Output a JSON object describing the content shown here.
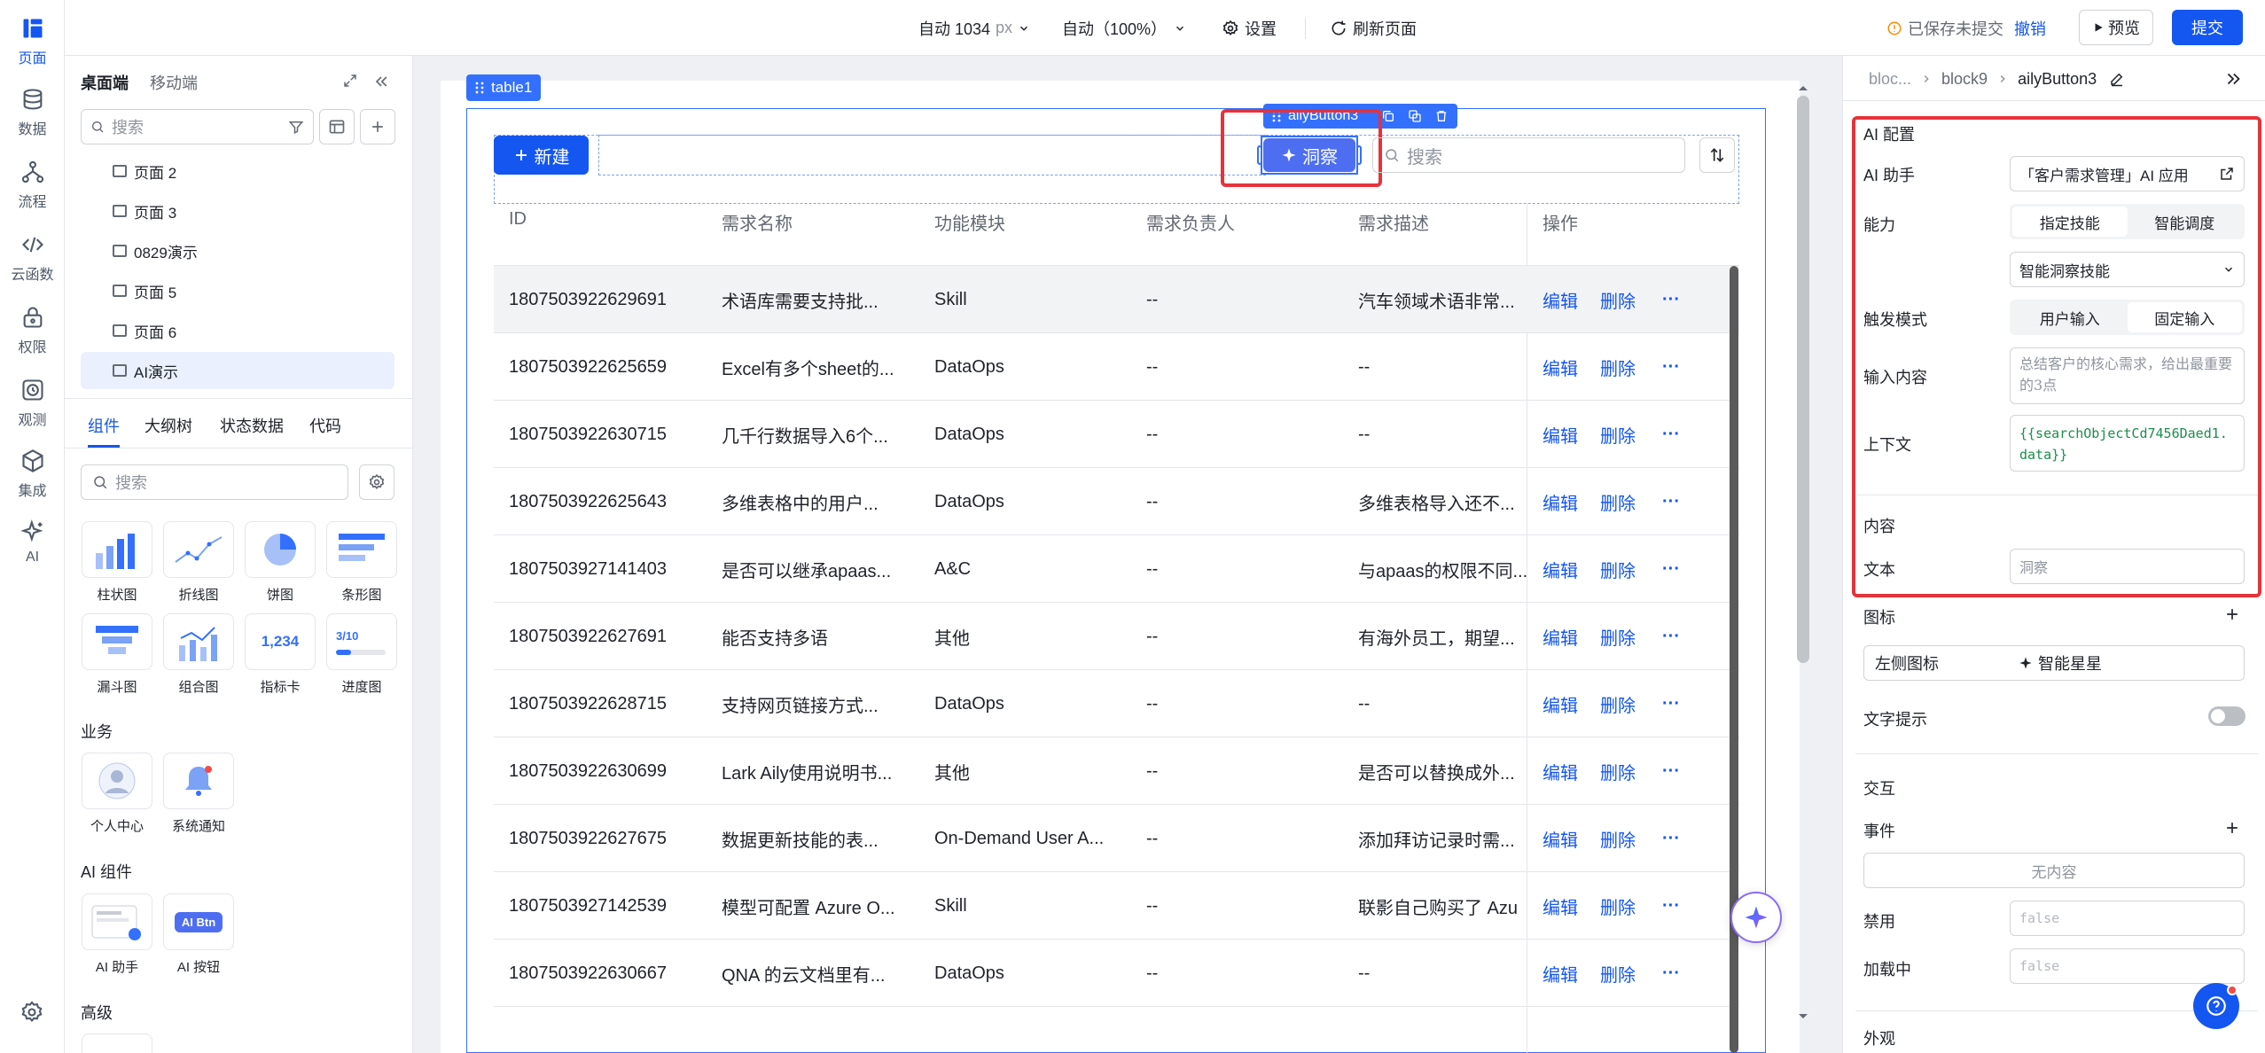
{
  "rail": {
    "items": [
      {
        "label": "页面",
        "icon": "page-icon",
        "active": true
      },
      {
        "label": "数据",
        "icon": "database-icon"
      },
      {
        "label": "流程",
        "icon": "flow-icon"
      },
      {
        "label": "云函数",
        "icon": "code-icon"
      },
      {
        "label": "权限",
        "icon": "lock-icon"
      },
      {
        "label": "观测",
        "icon": "monitor-icon"
      },
      {
        "label": "集成",
        "icon": "cube-icon"
      },
      {
        "label": "AI",
        "icon": "sparkle-icon"
      }
    ]
  },
  "topbar": {
    "width_label": "自动 1034",
    "width_unit": "px",
    "zoom_label": "自动（100%）",
    "settings_label": "设置",
    "refresh_label": "刷新页面",
    "save_status": "已保存未提交",
    "revoke_label": "撤销",
    "preview_label": "预览",
    "submit_label": "提交"
  },
  "left": {
    "device_tabs": [
      "桌面端",
      "移动端"
    ],
    "search_placeholder": "搜索",
    "pages": [
      "页面 2",
      "页面 3",
      "0829演示",
      "页面 5",
      "页面 6",
      "AI演示"
    ],
    "panel_tabs": [
      "组件",
      "大纲树",
      "状态数据",
      "代码"
    ],
    "component_search_placeholder": "搜索",
    "charts": [
      "柱状图",
      "折线图",
      "饼图",
      "条形图",
      "漏斗图",
      "组合图",
      "指标卡",
      "进度图"
    ],
    "metric_card_text": "1,234",
    "progress_text": "3/10",
    "business_title": "业务",
    "business": [
      "个人中心",
      "系统通知"
    ],
    "ai_title": "AI 组件",
    "ai_components": [
      "AI 助手",
      "AI 按钮"
    ],
    "ai_btn_thumb": "AI Btn",
    "advanced_title": "高级"
  },
  "canvas": {
    "table_tag": "table1",
    "button_tag": "ailyButton3",
    "new_button": "新建",
    "insight_button": "洞察",
    "search_placeholder": "搜索",
    "columns": [
      "ID",
      "需求名称",
      "功能模块",
      "需求负责人",
      "需求描述",
      "操作"
    ],
    "actions": {
      "edit": "编辑",
      "delete": "删除",
      "more": "···"
    },
    "rows": [
      {
        "id": "1807503922629691",
        "name": "术语库需要支持批...",
        "module": "Skill",
        "owner": "--",
        "desc": "汽车领域术语非常..."
      },
      {
        "id": "1807503922625659",
        "name": "Excel有多个sheet的...",
        "module": "DataOps",
        "owner": "--",
        "desc": "--"
      },
      {
        "id": "1807503922630715",
        "name": "几千行数据导入6个...",
        "module": "DataOps",
        "owner": "--",
        "desc": "--"
      },
      {
        "id": "1807503922625643",
        "name": "多维表格中的用户...",
        "module": "DataOps",
        "owner": "--",
        "desc": "多维表格导入还不..."
      },
      {
        "id": "1807503927141403",
        "name": "是否可以继承apaas...",
        "module": "A&C",
        "owner": "--",
        "desc": "与apaas的权限不同..."
      },
      {
        "id": "1807503922627691",
        "name": "能否支持多语",
        "module": "其他",
        "owner": "--",
        "desc": "有海外员工，期望..."
      },
      {
        "id": "1807503922628715",
        "name": "支持网页链接方式...",
        "module": "DataOps",
        "owner": "--",
        "desc": "--"
      },
      {
        "id": "1807503922630699",
        "name": "Lark Aily使用说明书...",
        "module": "其他",
        "owner": "--",
        "desc": "是否可以替换成外..."
      },
      {
        "id": "1807503922627675",
        "name": "数据更新技能的表...",
        "module": "On-Demand User A...",
        "owner": "--",
        "desc": "添加拜访记录时需..."
      },
      {
        "id": "1807503927142539",
        "name": "模型可配置 Azure O...",
        "module": "Skill",
        "owner": "--",
        "desc": "联影自己购买了 Azu"
      },
      {
        "id": "1807503922630667",
        "name": "QNA 的云文档里有...",
        "module": "DataOps",
        "owner": "--",
        "desc": "--"
      }
    ]
  },
  "right": {
    "breadcrumb": [
      "bloc...",
      "block9",
      "ailyButton3"
    ],
    "ai_config_title": "AI 配置",
    "assistant_label": "AI 助手",
    "assistant_value": "「客户需求管理」AI 应用",
    "capability_label": "能力",
    "capability_options": [
      "指定技能",
      "智能调度"
    ],
    "skill_value": "智能洞察技能",
    "trigger_label": "触发模式",
    "trigger_options": [
      "用户输入",
      "固定输入"
    ],
    "input_label": "输入内容",
    "input_placeholder": "总结客户的核心需求，给出最重要的3点",
    "context_label": "上下文",
    "context_value": "{{searchObjectCd7456Daed1.data}}",
    "content_title": "内容",
    "text_label": "文本",
    "text_placeholder": "洞察",
    "icon_title": "图标",
    "left_icon_label": "左侧图标",
    "left_icon_value": "智能星星",
    "tooltip_label": "文字提示",
    "interaction_title": "交互",
    "event_label": "事件",
    "event_empty": "无内容",
    "disabled_label": "禁用",
    "disabled_value": "false",
    "loading_label": "加载中",
    "loading_value": "false",
    "appearance_title": "外观"
  },
  "colors": {
    "primary": "#1456f0",
    "highlight": "#e5323b",
    "selection": "#3370ff"
  }
}
